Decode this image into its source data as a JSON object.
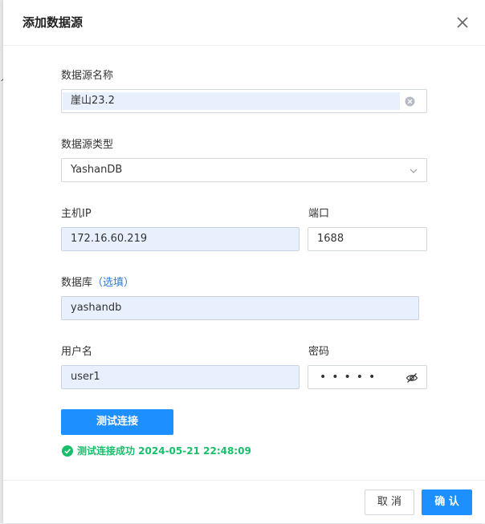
{
  "dialog": {
    "title": "添加数据源",
    "close_icon": "close-icon"
  },
  "form": {
    "name": {
      "label": "数据源名称",
      "value": "崖山23.2",
      "clear_icon": "clear-circle-icon"
    },
    "type": {
      "label": "数据源类型",
      "value": "YashanDB",
      "chevron_icon": "chevron-down-icon"
    },
    "host": {
      "label": "主机IP",
      "value": "172.16.60.219"
    },
    "port": {
      "label": "端口",
      "value": "1688"
    },
    "database": {
      "label": "数据库",
      "optional": "（选填）",
      "value": "yashandb"
    },
    "username": {
      "label": "用户名",
      "value": "user1"
    },
    "password": {
      "label": "密码",
      "masked": "•••••",
      "toggle_icon": "eye-hidden-icon"
    }
  },
  "test": {
    "button_label": "测试连接",
    "result_text": "测试连接成功 2024-05-21 22:48:09",
    "result_icon": "check-circle-icon",
    "result_color": "#19be6b"
  },
  "footer": {
    "cancel_label": "取 消",
    "confirm_label": "确 认"
  },
  "colors": {
    "primary": "#1e8fff",
    "autofill": "#e8f0fe",
    "link": "#2f7bd6"
  }
}
